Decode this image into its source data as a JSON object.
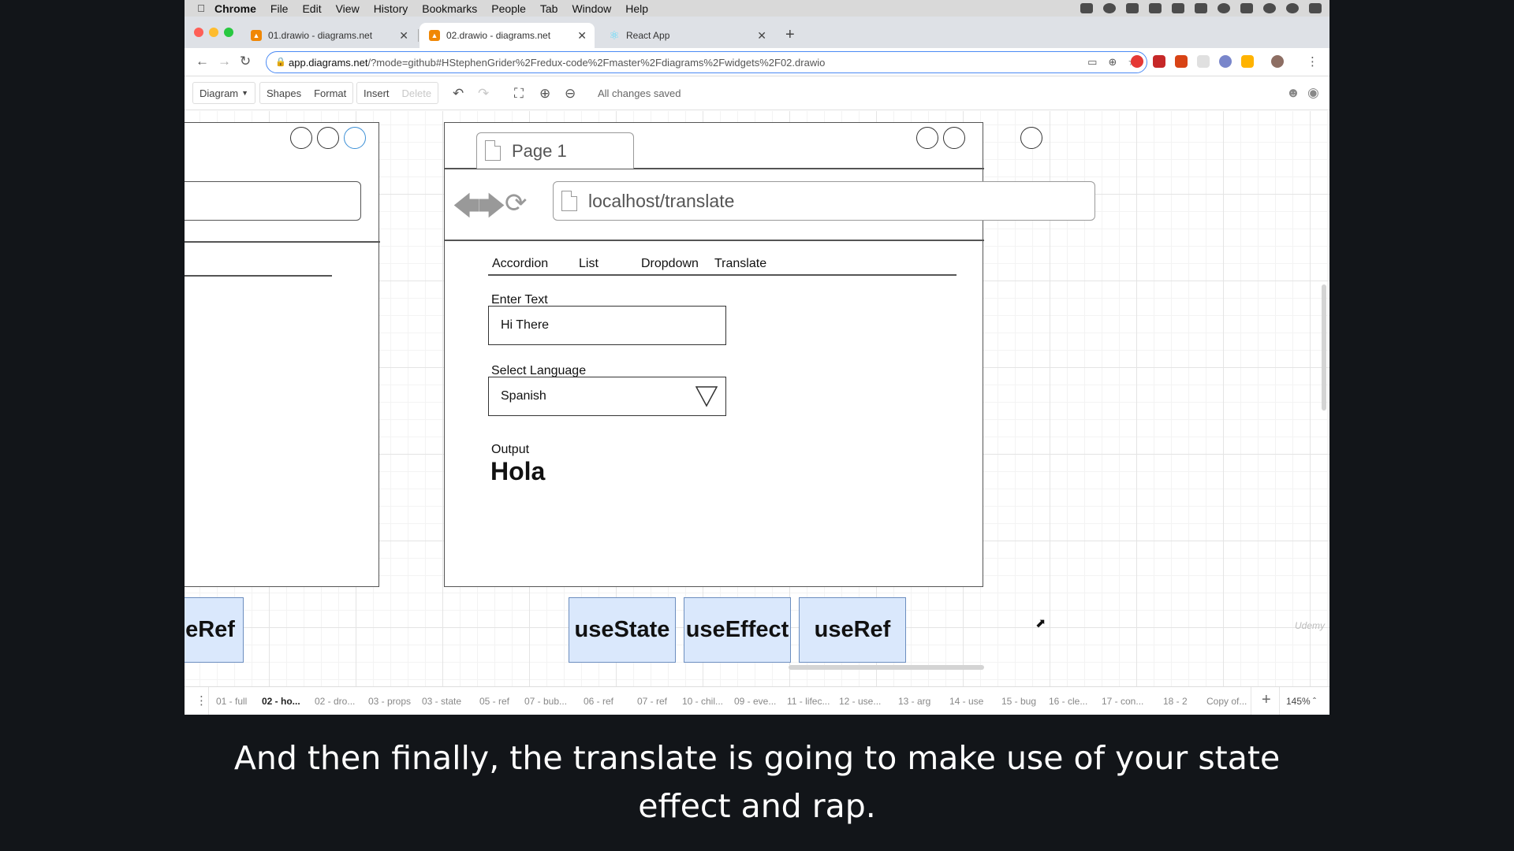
{
  "menubar": {
    "apple": "",
    "items": [
      "Chrome",
      "File",
      "Edit",
      "View",
      "History",
      "Bookmarks",
      "People",
      "Tab",
      "Window",
      "Help"
    ]
  },
  "tabs": [
    {
      "title": "01.drawio - diagrams.net",
      "active": false
    },
    {
      "title": "02.drawio - diagrams.net",
      "active": true
    },
    {
      "title": "React App",
      "active": false
    }
  ],
  "address": {
    "host": "app.diagrams.net",
    "path": "/?mode=github#HStephenGrider%2Fredux-code%2Fmaster%2Fdiagrams%2Fwidgets%2F02.drawio"
  },
  "toolbar": {
    "diagram": "Diagram",
    "shapes": "Shapes",
    "format": "Format",
    "insert": "Insert",
    "delete": "Delete",
    "status": "All changes saved"
  },
  "mockup": {
    "page_tab": "Page 1",
    "url": "localhost/translate",
    "nav": [
      "Accordion",
      "List",
      "Dropdown",
      "Translate"
    ],
    "enter_text_label": "Enter Text",
    "enter_text_value": "Hi There",
    "language_label": "Select Language",
    "language_value": "Spanish",
    "output_label": "Output",
    "output_value": "Hola"
  },
  "hooks": {
    "partial": "eRef",
    "items": [
      "useState",
      "useEffect",
      "useRef"
    ]
  },
  "page_tabs": [
    "01 - full",
    "02 - ho...",
    "02 - dro...",
    "03 - props",
    "03 - state",
    "05 - ref",
    "07 - bub...",
    "06 - ref",
    "07 - ref",
    "10 - chil...",
    "09 - eve...",
    "11 - lifec...",
    "12 - use...",
    "13 - arg",
    "14 - use",
    "15 - bug",
    "16 - cle...",
    "17 - con...",
    "18 - 2",
    "Copy of..."
  ],
  "zoom": "145%",
  "watermark": "Udemy",
  "subtitle": {
    "line1": "And then finally, the translate is going to make use of your state",
    "line2": "effect and rap."
  },
  "colors": {
    "hook_fill": "#dae8fc",
    "hook_border": "#6c8ebf",
    "focus_blue": "#4a8af4"
  }
}
